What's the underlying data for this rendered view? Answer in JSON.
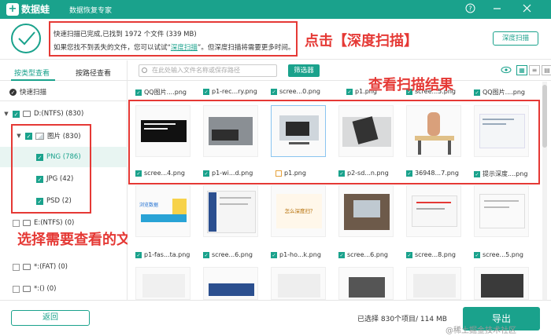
{
  "app": {
    "name": "数据蛙",
    "subtitle": "数据恢复专家",
    "icons": {
      "help": "question-icon",
      "minimize": "minimize-icon",
      "close": "close-icon"
    }
  },
  "banner": {
    "line1": "快速扫描已完成,已找到 1972 个文件 (339 MB)",
    "line2_pre": "如果您找不到丢失的文件，您可以试试“",
    "line2_link": "深度扫描",
    "line2_post": "”。但深度扫描将需要更多时间。",
    "deep_scan_button": "深度扫描"
  },
  "annotations": {
    "click_deep": "点击【深度扫描】",
    "view_results": "查看扫描结果",
    "choose_type": "选择需要查看的文件类型"
  },
  "sidebar": {
    "tabs": [
      "按类型查看",
      "按路径查看"
    ],
    "quick_scan": "快速扫描",
    "tree": {
      "drive_d": "D:(NTFS) (830)",
      "images": "图片 (830)",
      "png": "PNG (786)",
      "jpg": "JPG (42)",
      "psd": "PSD (2)",
      "drive_e": "E:(NTFS) (0)",
      "fat": "*:(FAT) (0)",
      "other": "*:() (0)"
    }
  },
  "toolbar": {
    "search_placeholder": "在此处输入文件名称或保存路径",
    "filter_button": "筛选器"
  },
  "files": {
    "row0": [
      "QQ图片....png",
      "p1-rec...ry.png",
      "scree...0.png",
      "p1.png",
      "scree...5.png",
      "QQ图片....png"
    ],
    "row1": [
      "scree...4.png",
      "p1-wi...d.png",
      "p1.png",
      "p2-sd...n.png",
      "36948...7.png",
      "提示深度....png"
    ],
    "row2": [
      "p1-fas...ta.png",
      "scree...6.png",
      "p1-ho...k.png",
      "scree...6.png",
      "scree...8.png",
      "scree...5.png"
    ]
  },
  "thumb_text": {
    "t1": "浏览数据",
    "t2": "怎么深度扫？"
  },
  "footer": {
    "back_button": "返回",
    "status": "已选择 830个项目/ 114 MB",
    "export_button": "导出"
  },
  "watermark": "@稀土掘金技术社区",
  "colors": {
    "accent": "#1aa28c",
    "annotation": "#e53935"
  }
}
